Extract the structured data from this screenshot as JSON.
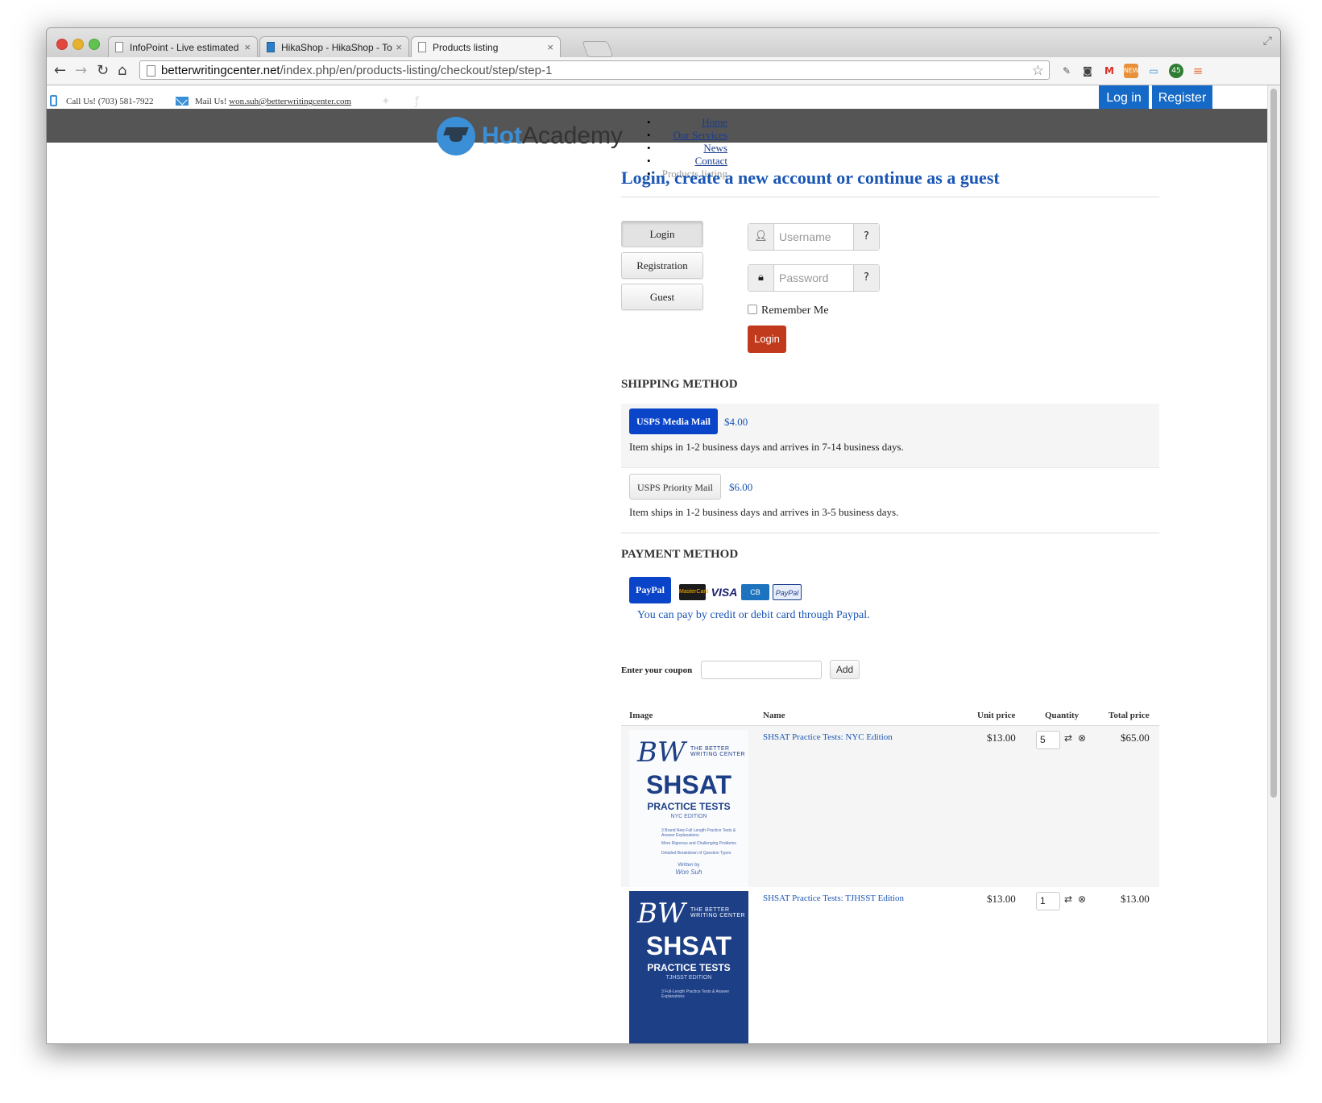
{
  "browser": {
    "tabs": [
      {
        "title": "InfoPoint - Live estimated",
        "active": false
      },
      {
        "title": "HikaShop - HikaShop - To",
        "active": false
      },
      {
        "title": "Products listing",
        "active": true
      }
    ],
    "url_host": "betterwritingcenter.net",
    "url_path": "/index.php/en/products-listing/checkout/step/step-1",
    "extension_badge": "45"
  },
  "topbar": {
    "call": "Call Us! (703) 581-7922",
    "mail_label": "Mail Us!",
    "mail_address": "won.suh@betterwritingcenter.com",
    "login": "Log in",
    "register": "Register"
  },
  "logo": {
    "hot": "Hot",
    "academy": "Academy"
  },
  "nav": [
    "Home",
    "Our Services",
    "News",
    "Contact",
    "Products listing"
  ],
  "checkout": {
    "title": "Login, create a new account or continue as a guest",
    "side_buttons": [
      "Login",
      "Registration",
      "Guest"
    ],
    "username_placeholder": "Username",
    "password_placeholder": "Password",
    "remember": "Remember Me",
    "login_button": "Login"
  },
  "shipping": {
    "heading": "SHIPPING METHOD",
    "methods": [
      {
        "name": "USPS Media Mail",
        "price": "$4.00",
        "desc": "Item ships in 1-2 business days and arrives in 7-14 business days.",
        "selected": true
      },
      {
        "name": "USPS Priority Mail",
        "price": "$6.00",
        "desc": "Item ships in 1-2 business days and arrives in 3-5 business days.",
        "selected": false
      }
    ]
  },
  "payment": {
    "heading": "PAYMENT METHOD",
    "method": "PayPal",
    "cards": [
      "MasterCard",
      "VISA",
      "CB",
      "PayPal"
    ],
    "desc": "You can pay by credit or debit card through Paypal."
  },
  "coupon": {
    "label": "Enter your coupon",
    "button": "Add"
  },
  "cart": {
    "headers": [
      "Image",
      "Name",
      "Unit price",
      "Quantity",
      "Total price"
    ],
    "rows": [
      {
        "name": "SHSAT Practice Tests: NYC Edition",
        "unit": "$13.00",
        "qty": "5",
        "total": "$65.00"
      },
      {
        "name": "SHSAT Practice Tests: TJHSST Edition",
        "unit": "$13.00",
        "qty": "1",
        "total": "$13.00"
      }
    ]
  },
  "covers": [
    {
      "brand": "THE BETTER WRITING CENTER",
      "title": "SHSAT",
      "subtitle": "PRACTICE TESTS",
      "edition": "NYC EDITION",
      "bullets": [
        "3 Brand New Full Length Practice Tests & Answer Explanations",
        "More Rigorous and Challenging Problems",
        "Detailed Breakdown of Question Types"
      ],
      "written_by": "Written by",
      "author": "Won Suh"
    },
    {
      "brand": "THE BETTER WRITING CENTER",
      "title": "SHSAT",
      "subtitle": "PRACTICE TESTS",
      "edition": "TJHSST EDITION",
      "bullets": [
        "3 Full-Length Practice Tests & Answer Explanations"
      ]
    }
  ],
  "colors": {
    "brand_blue": "#1569c7",
    "link_blue": "#1a56b5",
    "primary": "#0a44c9",
    "danger": "#c13a1e",
    "header_gray": "#555555"
  }
}
